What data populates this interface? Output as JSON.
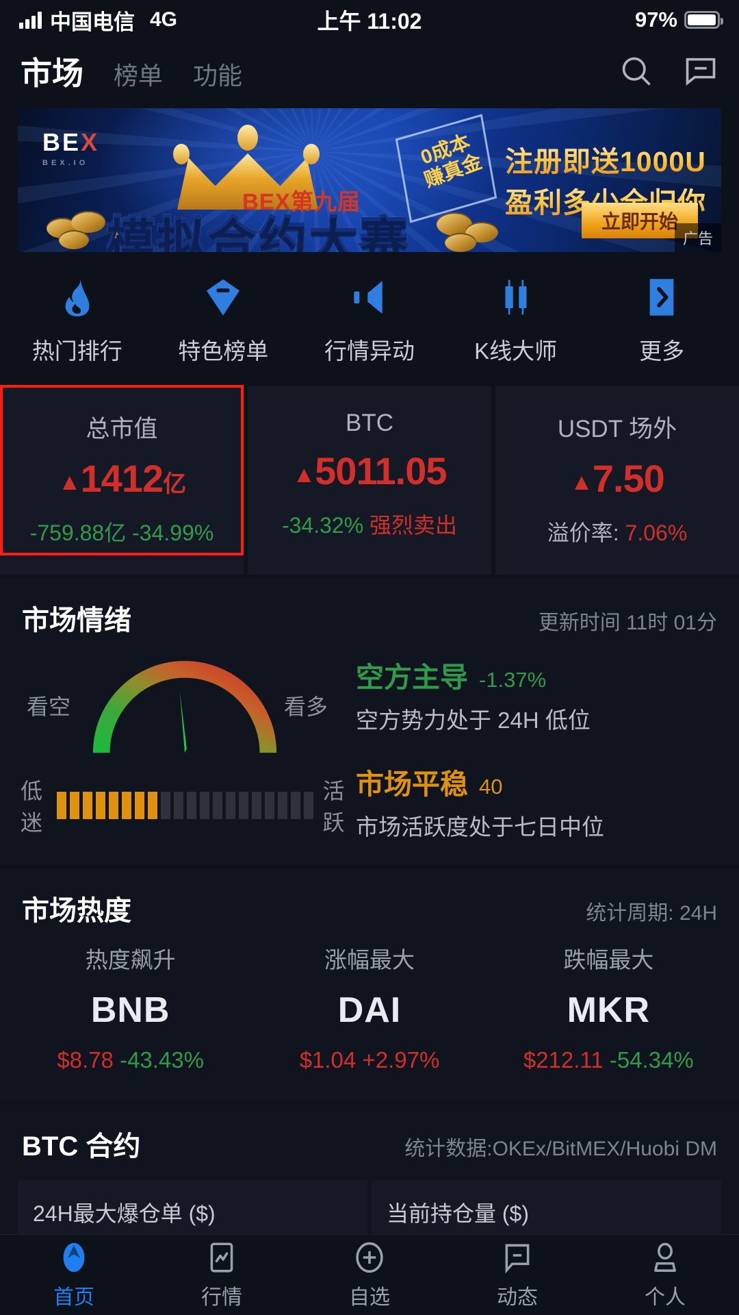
{
  "status_bar": {
    "carrier": "中国电信",
    "network": "4G",
    "time": "上午 11:02",
    "battery_percent": "97%",
    "battery_level": 97
  },
  "header": {
    "tabs": [
      {
        "label": "市场",
        "active": true
      },
      {
        "label": "榜单",
        "active": false
      },
      {
        "label": "功能",
        "active": false
      }
    ],
    "search_icon": "search-icon",
    "message_icon": "message-icon"
  },
  "banner": {
    "brand": "BE",
    "brand_accent": "X",
    "brand_sub": "BEX.IO",
    "edition": "BEX第九届",
    "title": "模拟合约大赛",
    "tilt_line1": "0成本",
    "tilt_line2": "赚真金",
    "ad_line1": "注册即送1000U",
    "ad_line2": "盈利多少全归你",
    "cta": "立即开始",
    "ad_tag": "广告"
  },
  "quick_actions": [
    {
      "label": "热门排行",
      "icon": "flame-icon"
    },
    {
      "label": "特色榜单",
      "icon": "gem-icon"
    },
    {
      "label": "行情异动",
      "icon": "megaphone-icon"
    },
    {
      "label": "K线大师",
      "icon": "candlestick-icon"
    },
    {
      "label": "更多",
      "icon": "chevron-right-icon"
    }
  ],
  "stat_cards": [
    {
      "title": "总市值",
      "arrow": "▲",
      "value": "1412",
      "unit": "亿",
      "sub_left": "-759.88亿",
      "sub_left_color": "green",
      "sub_right": "-34.99%",
      "sub_right_color": "green",
      "highlighted": true
    },
    {
      "title": "BTC",
      "arrow": "▲",
      "value": "5011.05",
      "unit": "",
      "sub_left": "-34.32%",
      "sub_left_color": "green",
      "sub_right": "强烈卖出",
      "sub_right_color": "red",
      "highlighted": false
    },
    {
      "title": "USDT 场外",
      "arrow": "▲",
      "value": "7.50",
      "unit": "",
      "sub_left": "溢价率:",
      "sub_left_color": "grey",
      "sub_right": "7.06%",
      "sub_right_color": "red",
      "highlighted": false
    }
  ],
  "sentiment": {
    "title": "市场情绪",
    "meta": "更新时间 11时 01分",
    "gauge_left_label": "看空",
    "gauge_right_label": "看多",
    "activity_left_label": "低迷",
    "activity_right_label": "活跃",
    "activity_filled": 8,
    "activity_total": 20,
    "gauge_needle_percent": 46,
    "rows": [
      {
        "headline": "空方主导",
        "headline_color": "green",
        "value": "-1.37%",
        "desc": "空方势力处于 24H 低位"
      },
      {
        "headline": "市场平稳",
        "headline_color": "orange",
        "value": "40",
        "desc": "市场活跃度处于七日中位"
      }
    ]
  },
  "market_heat": {
    "title": "市场热度",
    "meta": "统计周期: 24H",
    "columns": [
      {
        "label": "热度飙升",
        "symbol": "BNB",
        "price": "$8.78",
        "change": "-43.43%",
        "change_color": "green"
      },
      {
        "label": "涨幅最大",
        "symbol": "DAI",
        "price": "$1.04",
        "change": "+2.97%",
        "change_color": "red"
      },
      {
        "label": "跌幅最大",
        "symbol": "MKR",
        "price": "$212.11",
        "change": "-54.34%",
        "change_color": "green"
      }
    ]
  },
  "btc_contract": {
    "title": "BTC 合约",
    "meta": "统计数据:OKEx/BitMEX/Huobi DM",
    "boxes": [
      {
        "label": "24H最大爆仓单 ($)"
      },
      {
        "label": "当前持仓量 ($)"
      }
    ]
  },
  "bottom_nav": [
    {
      "label": "首页",
      "icon": "home-logo-icon",
      "active": true
    },
    {
      "label": "行情",
      "icon": "market-chart-icon",
      "active": false
    },
    {
      "label": "自选",
      "icon": "plus-circle-icon",
      "active": false
    },
    {
      "label": "动态",
      "icon": "chat-bubble-icon",
      "active": false
    },
    {
      "label": "个人",
      "icon": "person-icon",
      "active": false
    }
  ],
  "colors": {
    "background": "#0d1119",
    "card": "#141925",
    "accent_blue": "#2e7fe0",
    "up_red": "#d32f2a",
    "down_green": "#2f9c4a",
    "orange": "#e0920f",
    "highlight_box": "#ff1d15"
  }
}
